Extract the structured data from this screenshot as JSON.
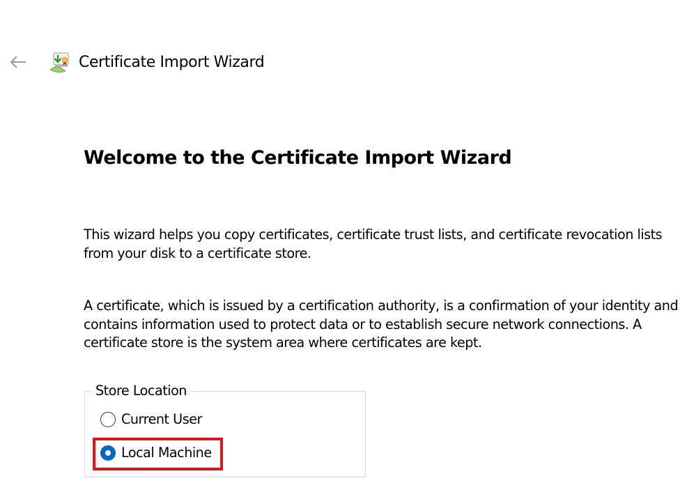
{
  "header": {
    "title": "Certificate Import Wizard",
    "back_icon": "arrow-left-icon",
    "app_icon": "certificate-import-icon"
  },
  "main": {
    "heading": "Welcome to the Certificate Import Wizard",
    "paragraph_1": "This wizard helps you copy certificates, certificate trust lists, and certificate revocation lists from your disk to a certificate store.",
    "paragraph_2": "A certificate, which is issued by a certification authority, is a confirmation of your identity and contains information used to protect data or to establish secure network connections. A certificate store is the system area where certificates are kept."
  },
  "store_location": {
    "legend": "Store Location",
    "options": [
      {
        "label": "Current User",
        "selected": false
      },
      {
        "label": "Local Machine",
        "selected": true
      }
    ]
  },
  "colors": {
    "accent": "#0067c0",
    "highlight": "#e0141e",
    "group_border": "#d9d9d9"
  }
}
